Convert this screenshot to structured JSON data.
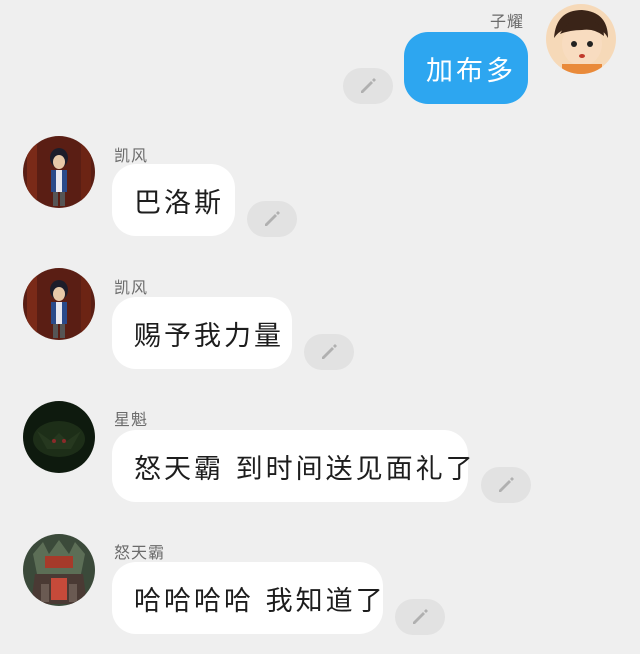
{
  "colors": {
    "self_bubble": "#2da6f0",
    "other_bubble": "#ffffff",
    "background": "#efefef"
  },
  "messages": [
    {
      "sender": "子耀",
      "text": "加布多",
      "side": "right"
    },
    {
      "sender": "凯风",
      "text": "巴洛斯",
      "side": "left"
    },
    {
      "sender": "凯风",
      "text": "赐予我力量",
      "side": "left"
    },
    {
      "sender": "星魁",
      "text": "怒天霸 到时间送见面礼了",
      "side": "left"
    },
    {
      "sender": "怒天霸",
      "text": "哈哈哈哈 我知道了",
      "side": "left"
    }
  ],
  "icons": {
    "edit": "pencil-icon"
  }
}
